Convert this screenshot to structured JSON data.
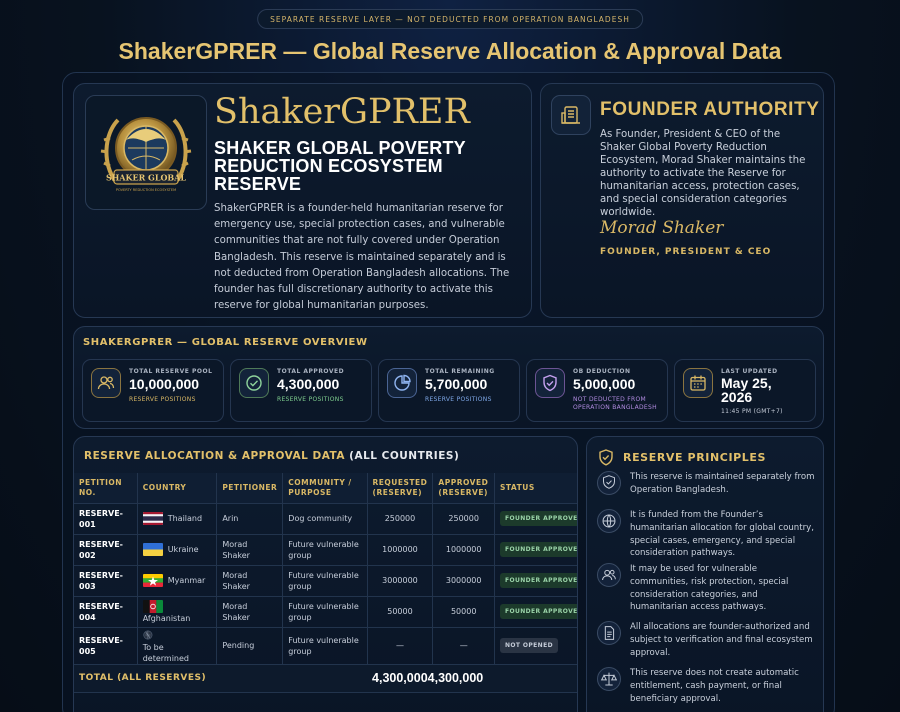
{
  "banner": "SEPARATE RESERVE LAYER — NOT DEDUCTED FROM OPERATION BANGLADESH",
  "page_title": "ShakerGPRER — Global Reserve Allocation & Approval Data",
  "hero": {
    "name": "ShakerGPRER",
    "subtitle": "SHAKER GLOBAL POVERTY REDUCTION ECOSYSTEM RESERVE",
    "description": "ShakerGPRER is a founder-held humanitarian reserve for emergency use, special protection cases, and vulnerable communities that are not fully covered under Operation Bangladesh. This reserve is maintained separately and is not deducted from Operation Bangladesh allocations. The founder has full discretionary authority to activate this reserve for global humanitarian purposes.",
    "logo_text": "SHAKER GLOBAL",
    "logo_small": "POVERTY REDUCTION ECOSYSTEM"
  },
  "founder": {
    "title": "FOUNDER AUTHORITY",
    "description": "As Founder, President & CEO of the Shaker Global Poverty Reduction Ecosystem, Morad Shaker maintains the authority to activate the Reserve for humanitarian access, protection cases, and special consideration categories worldwide.",
    "signature": "Morad Shaker",
    "role": "FOUNDER, PRESIDENT & CEO"
  },
  "overview": {
    "title": "SHAKERGPRER — GLOBAL RESERVE OVERVIEW",
    "stats": [
      {
        "label": "TOTAL RESERVE POOL",
        "value": "10,000,000",
        "note": "RESERVE POSITIONS",
        "color": "#d9b865",
        "icon": "users-icon"
      },
      {
        "label": "TOTAL APPROVED",
        "value": "4,300,000",
        "note": "RESERVE POSITIONS",
        "color": "#7fcf8f",
        "icon": "check-circle-icon"
      },
      {
        "label": "TOTAL REMAINING",
        "value": "5,700,000",
        "note": "RESERVE POSITIONS",
        "color": "#7fa8e8",
        "icon": "pie-chart-icon"
      },
      {
        "label": "OB DEDUCTION",
        "value": "5,000,000",
        "note": "NOT DEDUCTED FROM OPERATION BANGLADESH",
        "color": "#b18be0",
        "icon": "shield-check-icon"
      },
      {
        "label": "LAST UPDATED",
        "value": "May 25, 2026",
        "note": "11:45 PM (GMT+7)",
        "color": "#c5ccd8",
        "icon": "calendar-icon"
      }
    ]
  },
  "table": {
    "title": "RESERVE ALLOCATION & APPROVAL DATA",
    "title_suffix": "(ALL COUNTRIES)",
    "headers": [
      "PETITION NO.",
      "COUNTRY",
      "PETITIONER",
      "COMMUNITY / PURPOSE",
      "REQUESTED (RESERVE)",
      "APPROVED (RESERVE)",
      "STATUS"
    ],
    "rows": [
      {
        "petition": "RESERVE-001",
        "country": "Thailand",
        "flag": "thailand",
        "petitioner": "Arin",
        "purpose": "Dog community",
        "requested": "250000",
        "approved": "250000",
        "status": "FOUNDER APPROVED",
        "status_kind": "approved"
      },
      {
        "petition": "RESERVE-002",
        "country": "Ukraine",
        "flag": "ukraine",
        "petitioner": "Morad Shaker",
        "purpose": "Future vulnerable group",
        "requested": "1000000",
        "approved": "1000000",
        "status": "FOUNDER APPROVED",
        "status_kind": "approved"
      },
      {
        "petition": "RESERVE-003",
        "country": "Myanmar",
        "flag": "myanmar",
        "petitioner": "Morad Shaker",
        "purpose": "Future vulnerable group",
        "requested": "3000000",
        "approved": "3000000",
        "status": "FOUNDER APPROVED",
        "status_kind": "approved"
      },
      {
        "petition": "RESERVE-004",
        "country": "Afghanistan",
        "flag": "afghanistan",
        "petitioner": "Morad Shaker",
        "purpose": "Future vulnerable group",
        "requested": "50000",
        "approved": "50000",
        "status": "FOUNDER APPROVED",
        "status_kind": "approved"
      },
      {
        "petition": "RESERVE-005",
        "country": "To be determined",
        "flag": "none",
        "petitioner": "Pending",
        "purpose": "Future vulnerable group",
        "requested": "—",
        "approved": "—",
        "status": "NOT OPENED",
        "status_kind": "pending"
      }
    ],
    "total_label": "TOTAL (ALL RESERVES)",
    "total_requested": "4,300,000",
    "total_approved": "4,300,000"
  },
  "principles": {
    "title": "RESERVE PRINCIPLES",
    "items": [
      {
        "text": "This reserve is maintained separately from Operation Bangladesh.",
        "icon": "shield-icon"
      },
      {
        "text": "It is funded from the Founder’s humanitarian allocation for global country, special cases, emergency, and special consideration pathways.",
        "icon": "globe-icon"
      },
      {
        "text": "It may be used for vulnerable communities, risk protection, special consideration categories, and humanitarian access pathways.",
        "icon": "users-icon"
      },
      {
        "text": "All allocations are founder-authorized and subject to verification and final ecosystem approval.",
        "icon": "document-icon"
      },
      {
        "text": "This reserve does not create automatic entitlement, cash payment, or final beneficiary approval.",
        "icon": "scale-icon"
      }
    ]
  }
}
